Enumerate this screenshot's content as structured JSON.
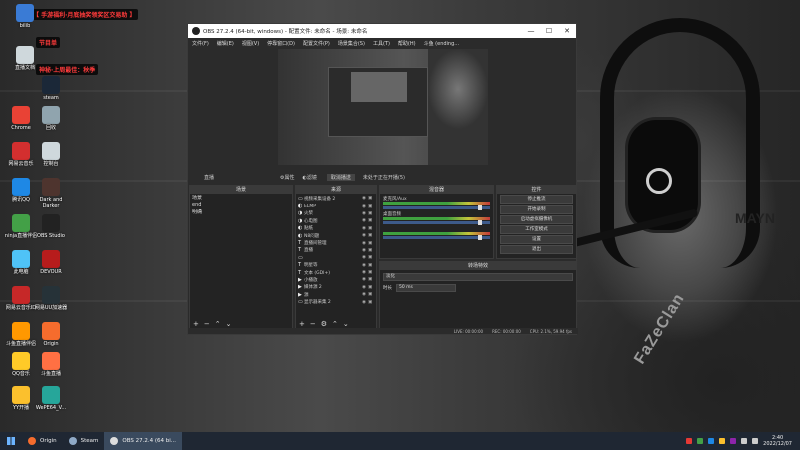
{
  "overlays": {
    "line1": "【 手游福利·月底抽奖领奖区交易助 】",
    "line2": "节目单",
    "line3": "神秘·上周最佳：秋季"
  },
  "desktop_icons": [
    {
      "label": "bilib",
      "color": "#3a7bd5"
    },
    {
      "label": "直播文档",
      "color": "#cfd8dc"
    },
    {
      "label": "steam",
      "color": "#1b2838"
    },
    {
      "label": "Chrome",
      "color": "#e94235"
    },
    {
      "label": "回收",
      "color": "#90a4ae"
    },
    {
      "label": "网易云音乐",
      "color": "#d32f2f"
    },
    {
      "label": "控制台",
      "color": "#cfd8dc"
    },
    {
      "label": "腾讯QQ",
      "color": "#1e88e5"
    },
    {
      "label": "Dark and Darker",
      "color": "#4e342e"
    },
    {
      "label": "ninja直播伴侣",
      "color": "#43a047"
    },
    {
      "label": "OBS Studio",
      "color": "#222222"
    },
    {
      "label": "此电脑",
      "color": "#4fc3f7"
    },
    {
      "label": "DEVOUR",
      "color": "#b71c1c"
    },
    {
      "label": "网易云音乐ID",
      "color": "#c62828"
    },
    {
      "label": "网易UU加速器",
      "color": "#263238"
    },
    {
      "label": "斗鱼直播伴侣",
      "color": "#ff9800"
    },
    {
      "label": "Origin",
      "color": "#f56c2d"
    },
    {
      "label": "QQ音乐",
      "color": "#ffca28"
    },
    {
      "label": "斗鱼直播",
      "color": "#ff7043"
    },
    {
      "label": "YY开播",
      "color": "#fbc02d"
    },
    {
      "label": "WePE64_V...",
      "color": "#26a69a"
    }
  ],
  "obs": {
    "title": "OBS 27.2.4 (64-bit, windows) - 配置文件: 未命名 - 场景: 未命名",
    "window_controls": {
      "minimize": "—",
      "maximize": "☐",
      "close": "✕"
    },
    "menu": [
      "文件(F)",
      "编辑(E)",
      "视图(V)",
      "停靠窗口(D)",
      "配置文件(P)",
      "场景集合(S)",
      "工具(T)",
      "帮助(H)",
      "斗鱼 (ending..."
    ],
    "toolbar": {
      "scene_label": "直播",
      "properties": "⚙属性",
      "filters": "◐滤镜",
      "stop_button": "取消播送",
      "status": "未处于正在开播(5)"
    },
    "scenes": {
      "header": "场景",
      "items": [
        "场景",
        "end",
        "明确"
      ]
    },
    "sources": {
      "header": "来源",
      "items": [
        {
          "icon": "▭",
          "name": "视频采集设备 2"
        },
        {
          "icon": "◐",
          "name": "ELMP"
        },
        {
          "icon": "◑",
          "name": "火柴"
        },
        {
          "icon": "◑",
          "name": "心电图"
        },
        {
          "icon": "◐",
          "name": "贴纸"
        },
        {
          "icon": "◐",
          "name": "N8问题"
        },
        {
          "icon": "T",
          "name": "直播间管理"
        },
        {
          "icon": "T",
          "name": "直播"
        },
        {
          "icon": "▭",
          "name": ""
        },
        {
          "icon": "T",
          "name": "明星等"
        },
        {
          "icon": "T",
          "name": "文本 (GDI+)"
        },
        {
          "icon": "▶",
          "name": "小播放"
        },
        {
          "icon": "▶",
          "name": "媒体源 2"
        },
        {
          "icon": "▶",
          "name": "源"
        },
        {
          "icon": "▭",
          "name": "显示器采集 2"
        }
      ]
    },
    "mixer": {
      "header": "混音器",
      "tracks": [
        {
          "name": "麦克风/Aux"
        },
        {
          "name": "桌面音频"
        },
        {
          "name": ""
        }
      ]
    },
    "controls": {
      "header": "控件",
      "buttons": [
        "停止推流",
        "开始录制",
        "启动虚拟摄像机",
        "工作室模式",
        "设置",
        "退出"
      ]
    },
    "transitions": {
      "header": "转场特效",
      "selected": "淡化",
      "duration_label": "时长",
      "duration_value": "50 ms"
    },
    "statusbar": {
      "live": "LIVE: 00:00:00",
      "rec": "REC: 00:00:00",
      "cpu": "CPU: 2.1%, 59.94 fps"
    }
  },
  "taskbar": {
    "items": [
      {
        "label": "Origin",
        "color": "#f56c2d"
      },
      {
        "label": "Steam",
        "color": "#1b2838"
      },
      {
        "label": "OBS 27.2.4 (64 bi...",
        "color": "#222222"
      }
    ],
    "time": "2:40",
    "date": "2022/12/07"
  }
}
